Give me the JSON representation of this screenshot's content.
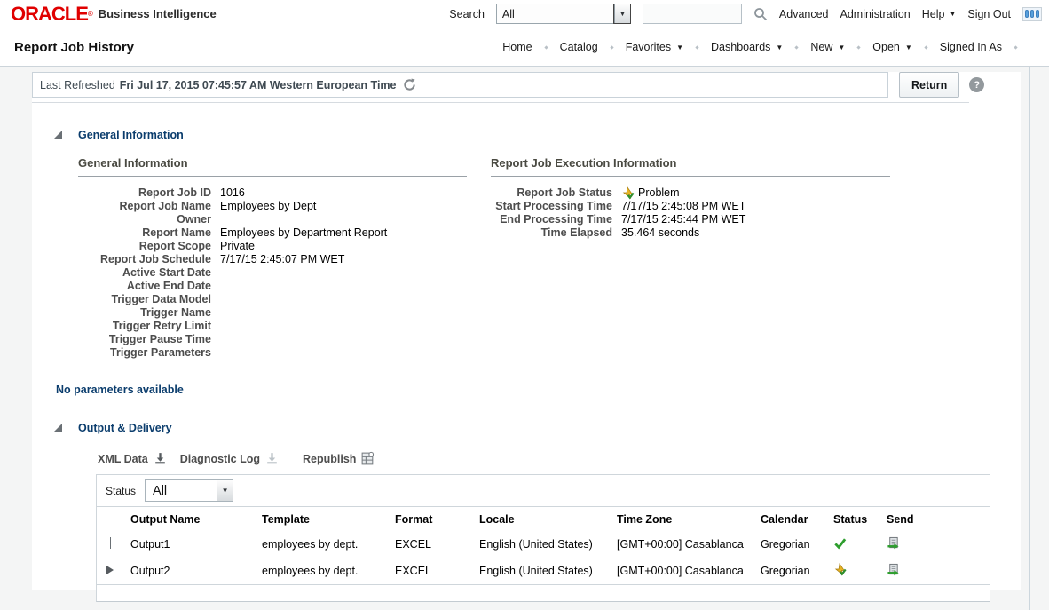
{
  "brand": {
    "logo": "ORACLE",
    "registered": "®",
    "product": "Business Intelligence"
  },
  "topbar": {
    "search_label": "Search",
    "search_scope": "All",
    "search_value": "",
    "advanced": "Advanced",
    "administration": "Administration",
    "help": "Help",
    "sign_out": "Sign Out"
  },
  "nav": {
    "page_title": "Report Job History",
    "home": "Home",
    "catalog": "Catalog",
    "favorites": "Favorites",
    "dashboards": "Dashboards",
    "new": "New",
    "open": "Open",
    "signed_in_as": "Signed In As"
  },
  "refresh_bar": {
    "label": "Last Refreshed",
    "timestamp": "Fri Jul 17, 2015 07:45:57 AM Western European Time",
    "return_button": "Return",
    "help_glyph": "?"
  },
  "general_section": {
    "header": "General Information",
    "subheader": "General Information",
    "fields": [
      {
        "label": "Report Job ID",
        "value": "1016"
      },
      {
        "label": "Report Job Name",
        "value": "Employees by Dept"
      },
      {
        "label": "Owner",
        "value": ""
      },
      {
        "label": "Report Name",
        "value": "Employees by Department Report"
      },
      {
        "label": "Report Scope",
        "value": "Private"
      },
      {
        "label": "Report Job Schedule",
        "value": "7/17/15 2:45:07 PM WET"
      },
      {
        "label": "Active Start Date",
        "value": ""
      },
      {
        "label": "Active End Date",
        "value": ""
      },
      {
        "label": "Trigger Data Model",
        "value": ""
      },
      {
        "label": "Trigger Name",
        "value": ""
      },
      {
        "label": "Trigger Retry Limit",
        "value": ""
      },
      {
        "label": "Trigger Pause Time",
        "value": ""
      },
      {
        "label": "Trigger Parameters",
        "value": ""
      }
    ]
  },
  "execution_section": {
    "subheader": "Report Job Execution Information",
    "status_label": "Report Job Status",
    "status_value": "Problem",
    "status_icon": "problem-icon",
    "fields": [
      {
        "label": "Start Processing Time",
        "value": "7/17/15 2:45:08 PM WET"
      },
      {
        "label": "End Processing Time",
        "value": "7/17/15 2:45:44 PM WET"
      },
      {
        "label": "Time Elapsed",
        "value": "35.464 seconds"
      }
    ]
  },
  "no_parameters_text": "No parameters available",
  "output_section": {
    "header": "Output & Delivery",
    "toolbar": {
      "xml_data": "XML Data",
      "diagnostic_log": "Diagnostic Log",
      "republish": "Republish"
    },
    "status_filter": {
      "label": "Status",
      "value": "All"
    },
    "table": {
      "columns": [
        "Output Name",
        "Template",
        "Format",
        "Locale",
        "Time Zone",
        "Calendar",
        "Status",
        "Send"
      ],
      "rows": [
        {
          "output_name": "Output1",
          "template": "employees by dept.",
          "format": "EXCEL",
          "locale": "English (United States)",
          "time_zone": "[GMT+00:00] Casablanca",
          "calendar": "Gregorian",
          "status": "success",
          "send": "send"
        },
        {
          "output_name": "Output2",
          "template": "employees by dept.",
          "format": "EXCEL",
          "locale": "English (United States)",
          "time_zone": "[GMT+00:00] Casablanca",
          "calendar": "Gregorian",
          "status": "problem",
          "send": "send"
        }
      ]
    }
  },
  "colors": {
    "oracle_red": "#e00000",
    "section_header_blue": "#0b3d6d",
    "success_green": "#2e9e2e",
    "warning_gold": "#e2a91c"
  }
}
